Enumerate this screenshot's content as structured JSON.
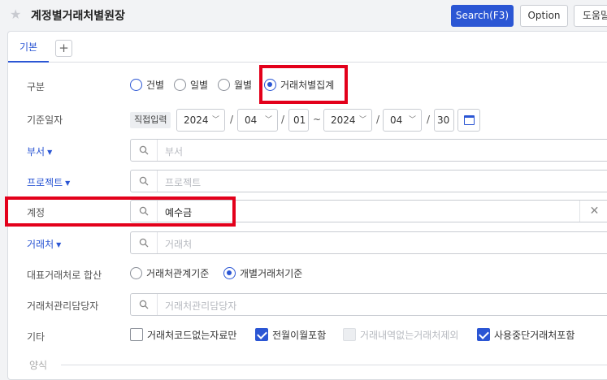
{
  "header": {
    "title": "계정별거래처별원장",
    "search_label": "Search(F3)",
    "option_label": "Option",
    "help_label": "도움말"
  },
  "tabs": [
    {
      "label": "기본"
    }
  ],
  "form": {
    "division": {
      "label": "구분",
      "options": [
        "건별",
        "일별",
        "월별",
        "거래처별집계"
      ],
      "selected": "거래처별집계"
    },
    "base_date": {
      "label": "기준일자",
      "badge": "직접입력",
      "from_year": "2024",
      "from_month": "04",
      "from_day": "01",
      "tilde": "~",
      "to_year": "2024",
      "to_month": "04",
      "to_day": "30",
      "slash": "/"
    },
    "department": {
      "label": "부서",
      "placeholder": "부서"
    },
    "project": {
      "label": "프로젝트",
      "placeholder": "프로젝트"
    },
    "account": {
      "label": "계정",
      "value": "예수금"
    },
    "customer": {
      "label": "거래처",
      "placeholder": "거래처"
    },
    "rep_sum": {
      "label": "대표거래처로 합산",
      "options": [
        "거래처관계기준",
        "개별거래처기준"
      ],
      "selected": "개별거래처기준"
    },
    "manager": {
      "label": "거래처관리담당자",
      "placeholder": "거래처관리담당자"
    },
    "etc": {
      "label": "기타",
      "options": [
        {
          "label": "거래처코드없는자료만",
          "checked": false,
          "disabled": false
        },
        {
          "label": "전월이월포함",
          "checked": true,
          "disabled": false
        },
        {
          "label": "거래내역없는거래처제외",
          "checked": false,
          "disabled": true
        },
        {
          "label": "사용중단거래처포함",
          "checked": true,
          "disabled": false
        }
      ]
    },
    "format": {
      "label": "양식"
    }
  },
  "colors": {
    "accent": "#2b56d4",
    "highlight": "#e3001b"
  }
}
